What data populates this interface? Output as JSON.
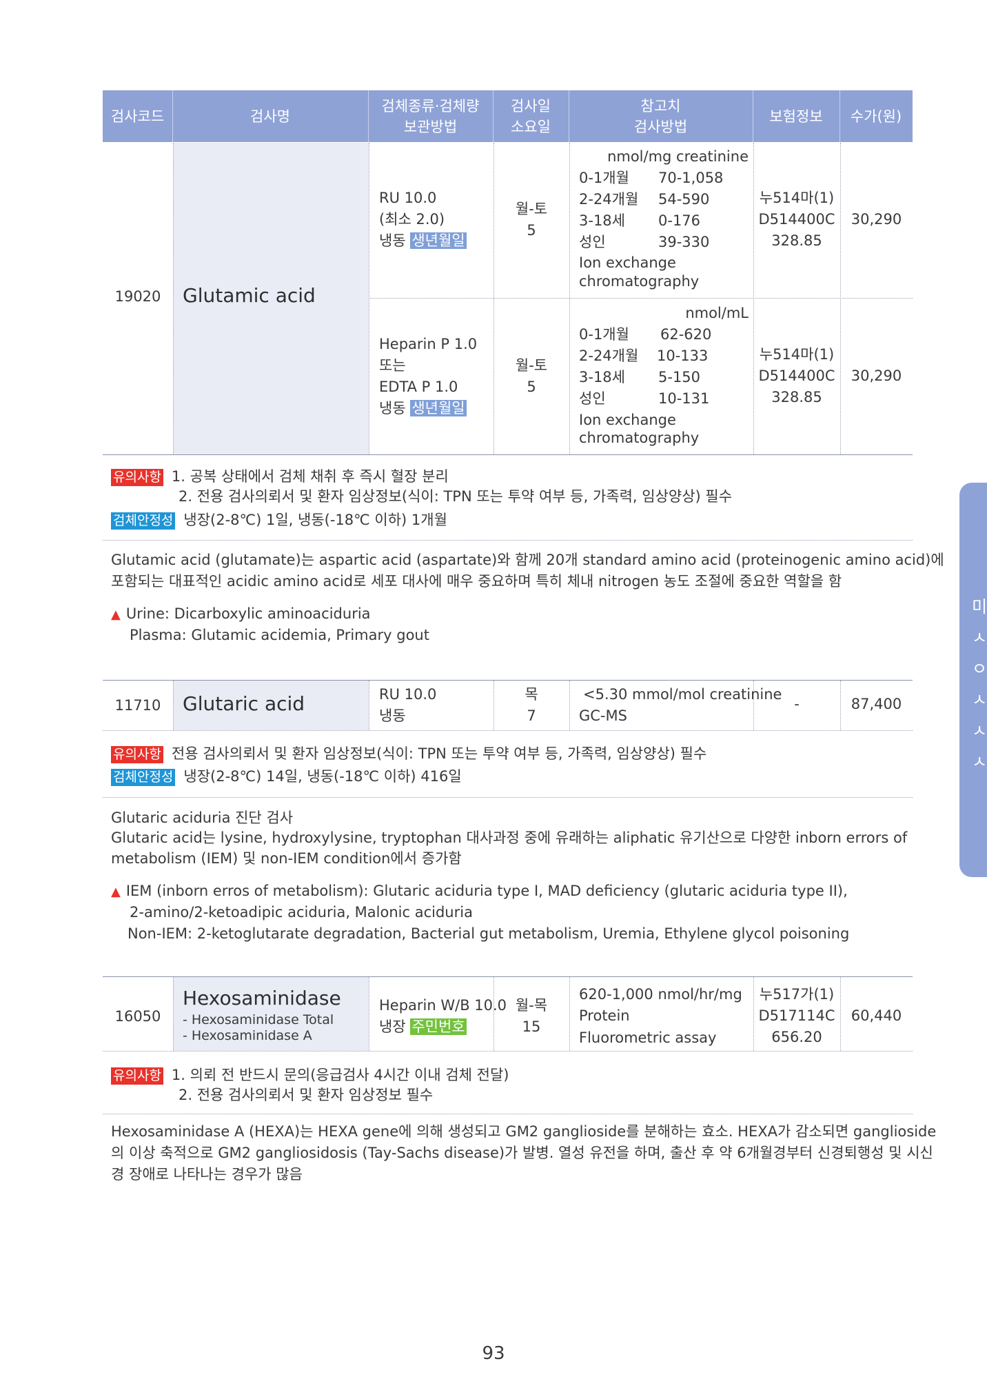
{
  "header": {
    "col1": "검사코드",
    "col2": "검사명",
    "col3a": "검체종류·검체량",
    "col3b": "보관방법",
    "col4a": "검사일",
    "col4b": "소요일",
    "col5a": "참고치",
    "col5b": "검사방법",
    "col6": "보험정보",
    "col7": "수가(원)"
  },
  "glutamic": {
    "code": "19020",
    "name": "Glutamic acid",
    "row1": {
      "spec1": "RU 10.0",
      "spec2": "(최소 2.0)",
      "spec3": "냉동",
      "spec3tag": "생년월일",
      "day": "월-토",
      "dur": "5",
      "unit": "nmol/mg creatinine",
      "ref": [
        [
          "0-1개월",
          "70-1,058"
        ],
        [
          "2-24개월",
          "54-590"
        ],
        [
          "3-18세",
          "0-176"
        ],
        [
          "성인",
          "39-330"
        ]
      ],
      "method1": "Ion exchange",
      "method2": "chromatography",
      "ins1": "누514마(1)",
      "ins2": "D514400C",
      "ins3": "328.85",
      "price": "30,290"
    },
    "row2": {
      "spec1": "Heparin P 1.0",
      "spec2": "또는",
      "spec3": "EDTA P 1.0",
      "spec4": "냉동",
      "spec4tag": "생년월일",
      "day": "월-토",
      "dur": "5",
      "unit": "nmol/mL",
      "ref": [
        [
          "0-1개월",
          "62-620"
        ],
        [
          "2-24개월",
          "10-133"
        ],
        [
          "3-18세",
          "5-150"
        ],
        [
          "성인",
          "10-131"
        ]
      ],
      "method1": "Ion exchange",
      "method2": "chromatography",
      "ins1": "누514마(1)",
      "ins2": "D514400C",
      "ins3": "328.85",
      "price": "30,290"
    },
    "note_tag": "유의사항",
    "note1": "1. 공복 상태에서 검체 채취 후 즉시 혈장 분리",
    "note2": "2. 전용 검사의뢰서 및 환자 임상정보(식이: TPN 또는 투약 여부 등, 가족력, 임상양상) 필수",
    "stab_tag": "검체안정성",
    "stab": "냉장(2-8℃) 1일, 냉동(-18℃ 이하) 1개월",
    "desc1": "Glutamic acid (glutamate)는 aspartic acid (aspartate)와 함께 20개 standard amino acid (proteinogenic amino acid)에",
    "desc2": "포함되는 대표적인 acidic amino acid로 세포 대사에 매우 중요하며 특히 체내 nitrogen 농도 조절에 중요한 역할을 함",
    "clin1": "Urine: Dicarboxylic aminoaciduria",
    "clin2": "Plasma: Glutamic acidemia, Primary gout"
  },
  "glutaric": {
    "code": "11710",
    "name": "Glutaric acid",
    "spec1": "RU 10.0",
    "spec2": "냉동",
    "day": "목",
    "dur": "7",
    "ref": "<5.30 mmol/mol creatinine",
    "method": "GC-MS",
    "ins": "-",
    "price": "87,400",
    "note_tag": "유의사항",
    "note": "전용 검사의뢰서 및 환자 임상정보(식이: TPN 또는 투약 여부 등, 가족력, 임상양상) 필수",
    "stab_tag": "검체안정성",
    "stab": "냉장(2-8℃) 14일, 냉동(-18℃ 이하) 416일",
    "desc1": "Glutaric aciduria 진단 검사",
    "desc2": "Glutaric acid는 lysine, hydroxylysine, tryptophan 대사과정 중에 유래하는 aliphatic 유기산으로 다양한 inborn errors of",
    "desc3": "metabolism (IEM) 및 non-IEM condition에서 증가함",
    "clin1": "IEM (inborn erros of metabolism): Glutaric aciduria type I, MAD deficiency (glutaric aciduria type II),",
    "clin2": "2-amino/2-ketoadipic aciduria, Malonic aciduria",
    "clin3": "Non-IEM: 2-ketoglutarate degradation, Bacterial gut metabolism, Uremia, Ethylene glycol poisoning"
  },
  "hexo": {
    "code": "16050",
    "name": "Hexosaminidase",
    "sub1": "- Hexosaminidase Total",
    "sub2": "- Hexosaminidase A",
    "spec1": "Heparin W/B 10.0",
    "spec2": "냉장",
    "spec2tag": "주민번호",
    "day": "월-목",
    "dur": "15",
    "ref1": "620-1,000 nmol/hr/mg",
    "ref2": "Protein",
    "method": "Fluorometric assay",
    "ins1": "누517가(1)",
    "ins2": "D517114C",
    "ins3": "656.20",
    "price": "60,440",
    "note_tag": "유의사항",
    "note1": "1. 의뢰 전 반드시 문의(응급검사 4시간 이내 검체 전달)",
    "note2": "2. 전용 검사의뢰서 및 환자 임상정보 필수",
    "desc1": "Hexosaminidase A (HEXA)는 HEXA gene에 의해 생성되고 GM2 ganglioside를 분해하는 효소. HEXA가 감소되면 ganglioside",
    "desc2": "의 이상 축적으로 GM2 gangliosidosis (Tay-Sachs disease)가 발병. 열성 유전을 하며, 출산 후 약 6개월경부터 신경퇴행성 및 시신",
    "desc3": "경 장애로 나타나는 경우가 많음"
  },
  "page_number": "93",
  "side_tab": [
    "미",
    "ㅅ",
    "ㅇ",
    "ㅅ",
    "ㅅ",
    "ㅅ"
  ]
}
